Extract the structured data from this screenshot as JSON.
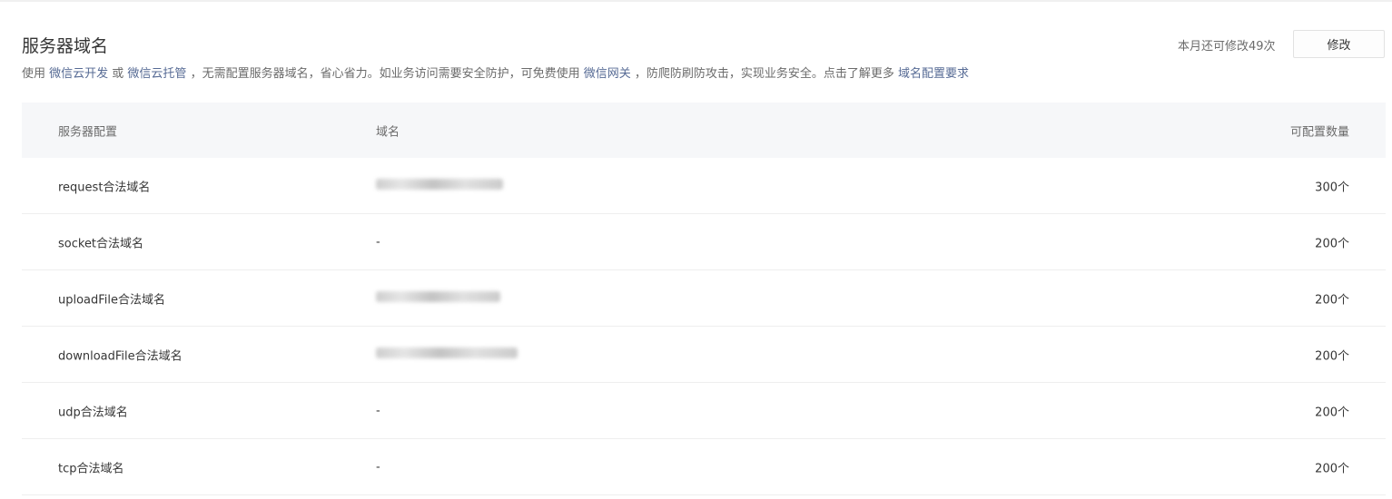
{
  "header": {
    "title": "服务器域名",
    "remaining_text": "本月还可修改49次",
    "modify_label": "修改"
  },
  "description": {
    "part1": "使用 ",
    "link1": "微信云开发",
    "part2": " 或 ",
    "link2": "微信云托管",
    "part3": " ，无需配置服务器域名，省心省力。如业务访问需要安全防护，可免费使用 ",
    "link3": "微信网关",
    "part4": " ，防爬防刷防攻击，实现业务安全。点击了解更多 ",
    "link4": "域名配置要求"
  },
  "table": {
    "headers": [
      "服务器配置",
      "域名",
      "可配置数量"
    ],
    "rows": [
      {
        "config": "request合法域名",
        "domain": "",
        "domain_blurred": true,
        "quantity": "300个"
      },
      {
        "config": "socket合法域名",
        "domain": "-",
        "domain_blurred": false,
        "quantity": "200个"
      },
      {
        "config": "uploadFile合法域名",
        "domain": "",
        "domain_blurred": true,
        "quantity": "200个"
      },
      {
        "config": "downloadFile合法域名",
        "domain": "",
        "domain_blurred": true,
        "quantity": "200个"
      },
      {
        "config": "udp合法域名",
        "domain": "-",
        "domain_blurred": false,
        "quantity": "200个"
      },
      {
        "config": "tcp合法域名",
        "domain": "-",
        "domain_blurred": false,
        "quantity": "200个"
      }
    ]
  }
}
